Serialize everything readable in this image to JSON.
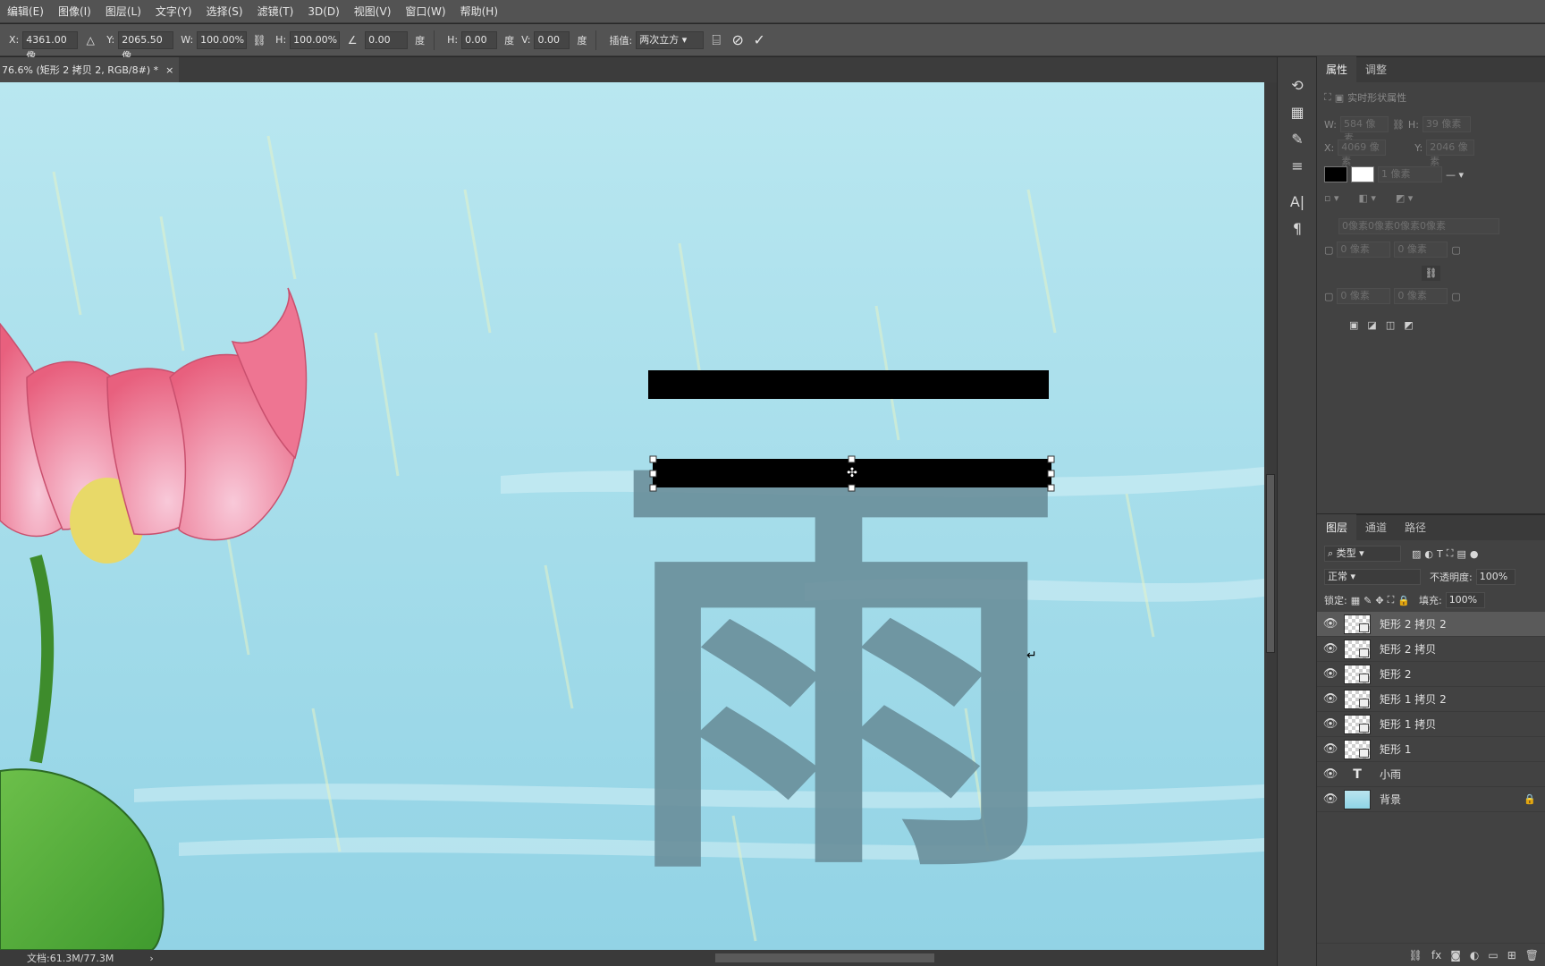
{
  "menu": [
    "编辑(E)",
    "图像(I)",
    "图层(L)",
    "文字(Y)",
    "选择(S)",
    "滤镜(T)",
    "3D(D)",
    "视图(V)",
    "窗口(W)",
    "帮助(H)"
  ],
  "options": {
    "x_label": "X:",
    "x_value": "4361.00 像",
    "y_label": "Y:",
    "y_value": "2065.50 像",
    "w_label": "W:",
    "w_value": "100.00%",
    "h_label": "H:",
    "h_value": "100.00%",
    "rot_value": "0.00",
    "rot_unit": "度",
    "skew_h_label": "H:",
    "skew_h_value": "0.00",
    "skew_h_unit": "度",
    "skew_v_label": "V:",
    "skew_v_value": "0.00",
    "skew_v_unit": "度",
    "interp_label": "插值:",
    "interp_value": "两次立方"
  },
  "document": {
    "tab_title": "76.6% (矩形 2 拷贝 2, RGB/8#) *",
    "close": "×"
  },
  "canvas": {
    "glyph": "雨",
    "background_color": "#9fdbe9",
    "glyph_color": "#6a8f9b",
    "selected_fill": "#000000"
  },
  "status": {
    "doc_size": "文档:61.3M/77.3M",
    "arrow": "›"
  },
  "properties": {
    "tabs": [
      "属性",
      "调整"
    ],
    "title": "实时形状属性",
    "w_label": "W:",
    "w_value": "584 像素",
    "h_label": "H:",
    "h_value": "39 像素",
    "x_label": "X:",
    "x_value": "4069 像素",
    "y_label": "Y:",
    "y_value": "2046 像素",
    "stroke_value": "1 像素",
    "radius_all": "0像素0像素0像素0像素",
    "radius_tl": "0 像素",
    "radius_tr": "0 像素",
    "radius_bl": "0 像素",
    "radius_br": "0 像素"
  },
  "layers": {
    "tabs": [
      "图层",
      "通道",
      "路径"
    ],
    "filter": "类型",
    "blend": "正常",
    "opacity_label": "不透明度:",
    "opacity_value": "100%",
    "lock_label": "锁定:",
    "fill_label": "填充:",
    "fill_value": "100%",
    "items": [
      {
        "name": "矩形 2 拷贝 2",
        "kind": "shape",
        "selected": true
      },
      {
        "name": "矩形 2 拷贝",
        "kind": "shape"
      },
      {
        "name": "矩形 2",
        "kind": "shape"
      },
      {
        "name": "矩形 1 拷贝 2",
        "kind": "shape"
      },
      {
        "name": "矩形 1 拷贝",
        "kind": "shape"
      },
      {
        "name": "矩形 1",
        "kind": "shape"
      },
      {
        "name": "小雨",
        "kind": "text"
      },
      {
        "name": "背景",
        "kind": "background",
        "locked": true
      }
    ],
    "bottom_icons": [
      "link-icon",
      "fx-icon",
      "mask-icon",
      "adjustment-icon",
      "folder-icon",
      "new-layer-icon",
      "trash-icon"
    ],
    "fx_label": "fx"
  }
}
